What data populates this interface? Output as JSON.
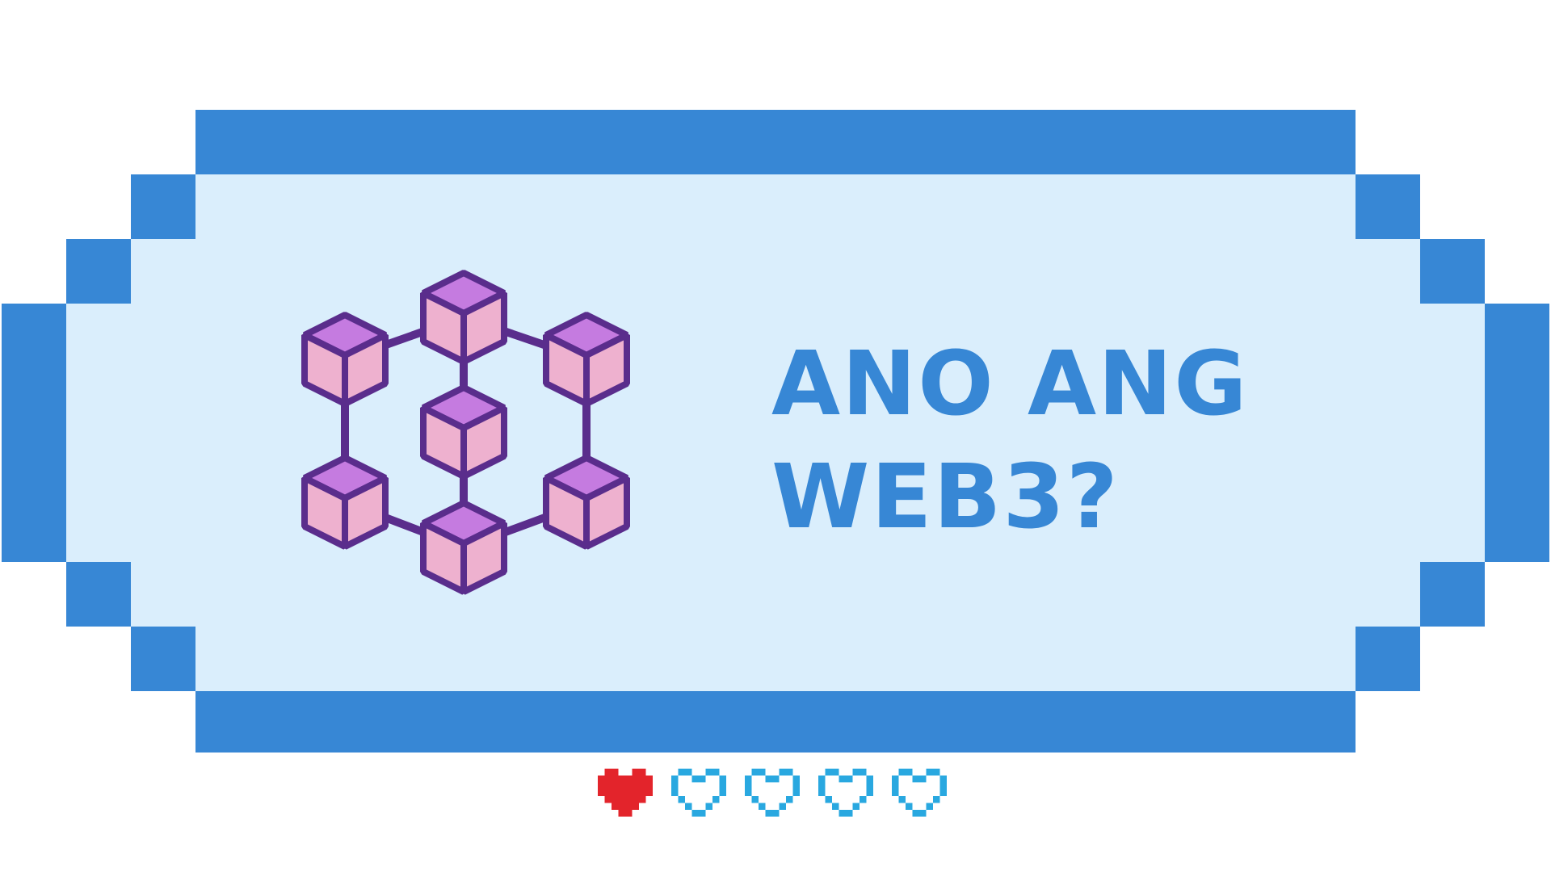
{
  "title": {
    "line1": "ANO ANG",
    "line2": "WEB3?"
  },
  "progress": {
    "filled": 1,
    "total": 5
  },
  "colors": {
    "frame_blue": "#3787d5",
    "panel_fill": "#daeefc",
    "title_text": "#3787d5",
    "heart_filled": "#e3242b",
    "heart_outline": "#29a8e0",
    "cube_top": "#c57be0",
    "cube_side": "#eeb1cf",
    "cube_outline": "#5a2d8c"
  },
  "icons": {
    "illustration": "blockchain-network-icon",
    "progress_marker": "pixel-heart-icon"
  }
}
